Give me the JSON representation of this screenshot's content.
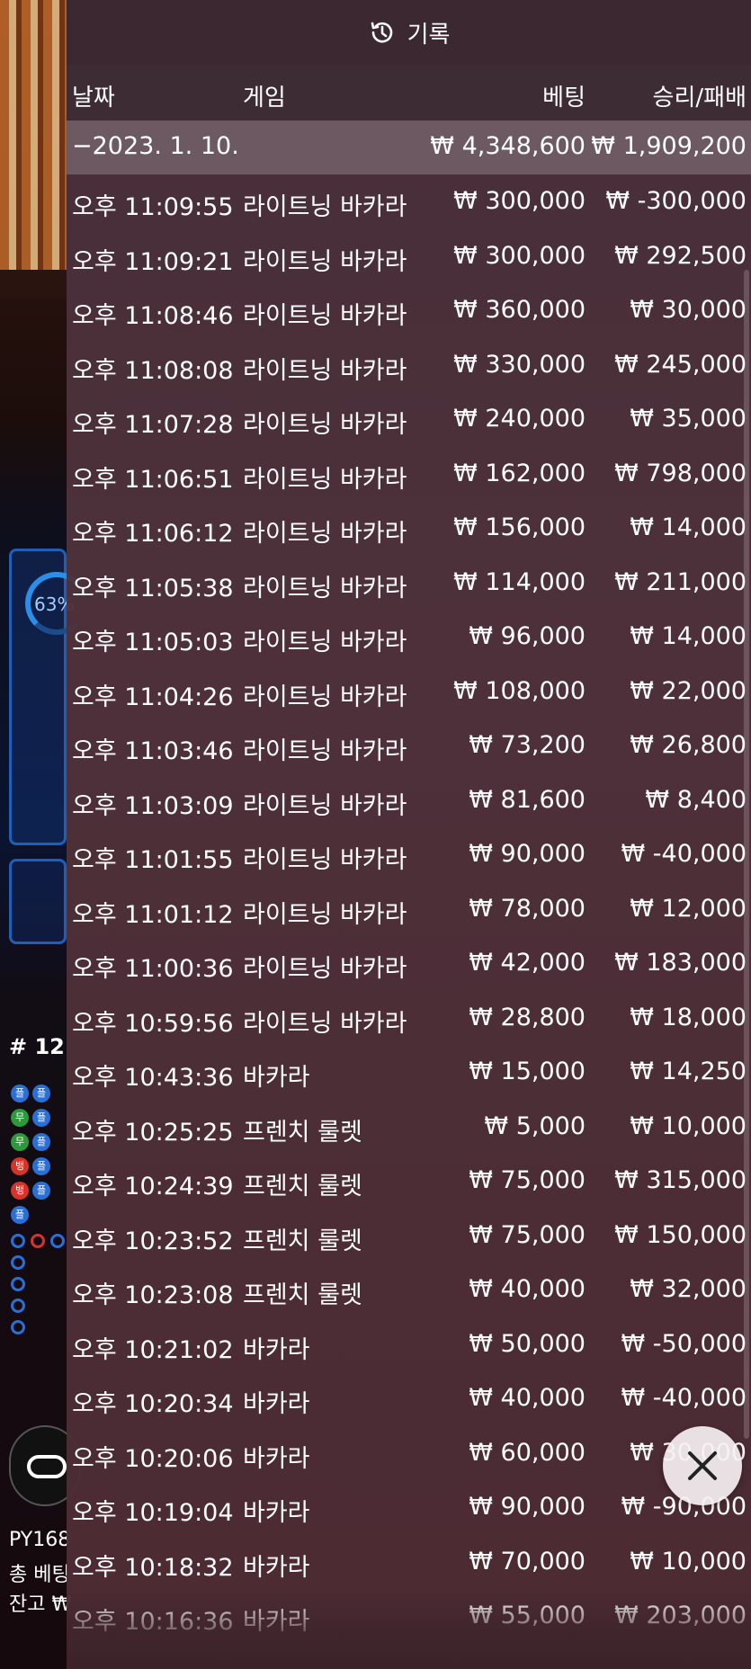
{
  "background": {
    "ring_percent": "63%",
    "round_label": "# 12",
    "beads": [
      "플",
      "플",
      "무",
      "플",
      "무",
      "플",
      "뱅",
      "플",
      "뱅",
      "플",
      "플"
    ],
    "bottom_line1": "PY168",
    "bottom_line2": "총 베팅",
    "bottom_line3": "잔고 ₩"
  },
  "header": {
    "title": "기록",
    "icon": "history-icon"
  },
  "columns": {
    "date": "날짜",
    "game": "게임",
    "bet": "베팅",
    "winloss": "승리/패배"
  },
  "summary": {
    "date": "−2023. 1. 10.",
    "bet": "₩ 4,348,600",
    "winloss": "₩ 1,909,200"
  },
  "rows": [
    {
      "time": "오후 11:09:55",
      "game": "라이트닝 바카라",
      "bet": "₩ 300,000",
      "winloss": "₩ -300,000"
    },
    {
      "time": "오후 11:09:21",
      "game": "라이트닝 바카라",
      "bet": "₩ 300,000",
      "winloss": "₩ 292,500"
    },
    {
      "time": "오후 11:08:46",
      "game": "라이트닝 바카라",
      "bet": "₩ 360,000",
      "winloss": "₩ 30,000"
    },
    {
      "time": "오후 11:08:08",
      "game": "라이트닝 바카라",
      "bet": "₩ 330,000",
      "winloss": "₩ 245,000"
    },
    {
      "time": "오후 11:07:28",
      "game": "라이트닝 바카라",
      "bet": "₩ 240,000",
      "winloss": "₩ 35,000"
    },
    {
      "time": "오후 11:06:51",
      "game": "라이트닝 바카라",
      "bet": "₩ 162,000",
      "winloss": "₩ 798,000"
    },
    {
      "time": "오후 11:06:12",
      "game": "라이트닝 바카라",
      "bet": "₩ 156,000",
      "winloss": "₩ 14,000"
    },
    {
      "time": "오후 11:05:38",
      "game": "라이트닝 바카라",
      "bet": "₩ 114,000",
      "winloss": "₩ 211,000"
    },
    {
      "time": "오후 11:05:03",
      "game": "라이트닝 바카라",
      "bet": "₩ 96,000",
      "winloss": "₩ 14,000"
    },
    {
      "time": "오후 11:04:26",
      "game": "라이트닝 바카라",
      "bet": "₩ 108,000",
      "winloss": "₩ 22,000"
    },
    {
      "time": "오후 11:03:46",
      "game": "라이트닝 바카라",
      "bet": "₩ 73,200",
      "winloss": "₩ 26,800"
    },
    {
      "time": "오후 11:03:09",
      "game": "라이트닝 바카라",
      "bet": "₩ 81,600",
      "winloss": "₩ 8,400"
    },
    {
      "time": "오후 11:01:55",
      "game": "라이트닝 바카라",
      "bet": "₩ 90,000",
      "winloss": "₩ -40,000"
    },
    {
      "time": "오후 11:01:12",
      "game": "라이트닝 바카라",
      "bet": "₩ 78,000",
      "winloss": "₩ 12,000"
    },
    {
      "time": "오후 11:00:36",
      "game": "라이트닝 바카라",
      "bet": "₩ 42,000",
      "winloss": "₩ 183,000"
    },
    {
      "time": "오후 10:59:56",
      "game": "라이트닝 바카라",
      "bet": "₩ 28,800",
      "winloss": "₩ 18,000"
    },
    {
      "time": "오후 10:43:36",
      "game": "바카라",
      "bet": "₩ 15,000",
      "winloss": "₩ 14,250"
    },
    {
      "time": "오후 10:25:25",
      "game": "프렌치 룰렛",
      "bet": "₩ 5,000",
      "winloss": "₩ 10,000"
    },
    {
      "time": "오후 10:24:39",
      "game": "프렌치 룰렛",
      "bet": "₩ 75,000",
      "winloss": "₩ 315,000"
    },
    {
      "time": "오후 10:23:52",
      "game": "프렌치 룰렛",
      "bet": "₩ 75,000",
      "winloss": "₩ 150,000"
    },
    {
      "time": "오후 10:23:08",
      "game": "프렌치 룰렛",
      "bet": "₩ 40,000",
      "winloss": "₩ 32,000"
    },
    {
      "time": "오후 10:21:02",
      "game": "바카라",
      "bet": "₩ 50,000",
      "winloss": "₩ -50,000"
    },
    {
      "time": "오후 10:20:34",
      "game": "바카라",
      "bet": "₩ 40,000",
      "winloss": "₩ -40,000"
    },
    {
      "time": "오후 10:20:06",
      "game": "바카라",
      "bet": "₩ 60,000",
      "winloss": "₩ 30,000"
    },
    {
      "time": "오후 10:19:04",
      "game": "바카라",
      "bet": "₩ 90,000",
      "winloss": "₩ -90,000"
    },
    {
      "time": "오후 10:18:32",
      "game": "바카라",
      "bet": "₩ 70,000",
      "winloss": "₩ 10,000"
    },
    {
      "time": "오후 10:16:36",
      "game": "바카라",
      "bet": "₩ 55,000",
      "winloss": "₩ 203,000"
    }
  ],
  "close_button": {
    "icon": "close-icon"
  }
}
